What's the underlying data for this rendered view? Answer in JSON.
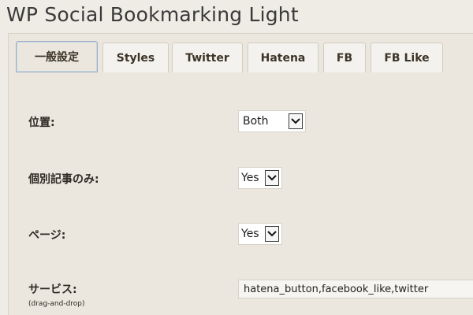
{
  "page": {
    "title": "WP Social Bookmarking Light"
  },
  "tabs": [
    {
      "label": "一般設定",
      "active": true
    },
    {
      "label": "Styles",
      "active": false
    },
    {
      "label": "Twitter",
      "active": false
    },
    {
      "label": "Hatena",
      "active": false
    },
    {
      "label": "FB",
      "active": false
    },
    {
      "label": "FB Like",
      "active": false
    }
  ],
  "settings": {
    "position": {
      "label": "位置:",
      "value": "Both"
    },
    "single_only": {
      "label": "個別記事のみ:",
      "value": "Yes"
    },
    "page": {
      "label": "ページ:",
      "value": "Yes"
    },
    "services": {
      "label": "サービス:",
      "sublabel": "(drag-and-drop)",
      "value": "hatena_button,facebook_like,twitter"
    }
  },
  "icons": {
    "dropdown": "chevron-down-icon"
  },
  "colors": {
    "background": "#efece6",
    "active_tab_border": "#9cb0c4",
    "text": "#2e2a24"
  }
}
